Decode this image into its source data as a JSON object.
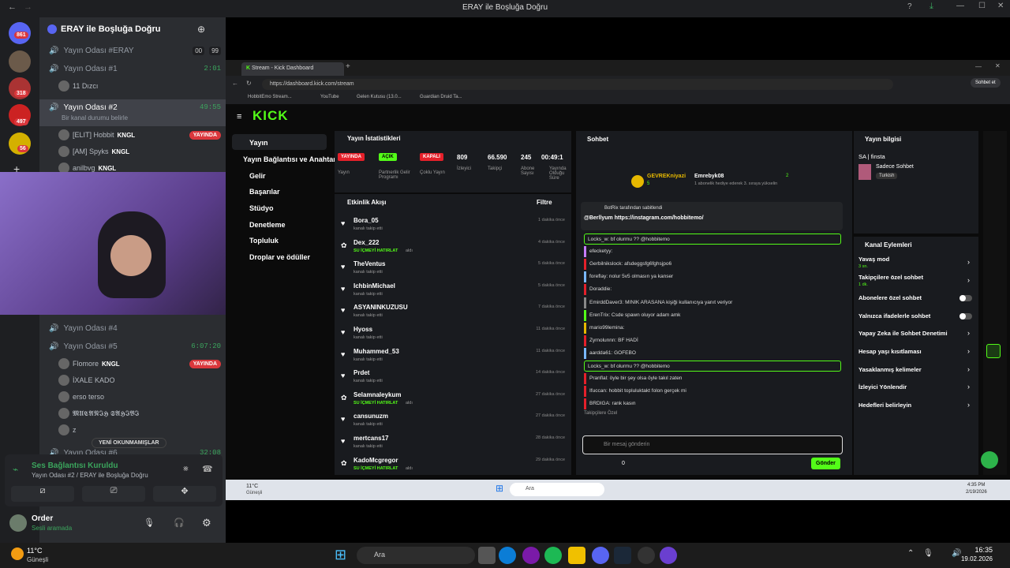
{
  "window_title": "ERAY ile Boşluğa Doğru",
  "server": {
    "name": "ERAY ile Boşluğa Doğru",
    "badges": [
      "861",
      "318",
      "497",
      "56"
    ]
  },
  "channels": {
    "yayin_durumu": {
      "label": "Yayın Odası #ERAY",
      "count_a": "00",
      "count_b": "99"
    },
    "oda1": {
      "label": "Yayın Odası #1",
      "timer": "2:01",
      "user": "11 Dızcı"
    },
    "oda2": {
      "label": "Yayın Odası #2",
      "timer": "49:55",
      "status": "Bir kanal durumu belirle"
    },
    "oda2_users": [
      {
        "name": "[ELIT] Hobbit",
        "tag": "KNGL",
        "live": "YAYINDA"
      },
      {
        "name": "[AM] Spyks",
        "tag": "KNGL",
        "live": ""
      },
      {
        "name": "anilbvg",
        "tag": "KNGL",
        "live": ""
      }
    ],
    "oda4": {
      "label": "Yayın Odası #4"
    },
    "oda5": {
      "label": "Yayın Odası #5",
      "timer": "6:07:20"
    },
    "oda5_users": [
      {
        "name": "Flomore",
        "tag": "KNGL",
        "live": "YAYINDA"
      },
      {
        "name": "İXALE KADO",
        "tag": "",
        "live": ""
      },
      {
        "name": "erso terso",
        "tag": "",
        "live": ""
      },
      {
        "name": "𝕸𝖀𝕮𝕬𝕹𝕴𝕳 𝕾𝕬𝕳𝕴𝕭𝕴",
        "tag": "",
        "live": ""
      },
      {
        "name": "z",
        "tag": "",
        "live": ""
      }
    ],
    "oda6": {
      "label": "Yayın Odası #6",
      "timer": "32:08"
    },
    "unread_pill": "YENİ OKUNMAMIŞLAR"
  },
  "voice": {
    "title": "Ses Bağlantısı Kuruldu",
    "subtitle": "Yayın Odası #2 / ERAY ile Boşluğa Doğru"
  },
  "user": {
    "name": "Order",
    "status": "Sesli aramada"
  },
  "browser": {
    "tab_title": "Stream - Kick Dashboard",
    "url": "https://dashboard.kick.com/stream",
    "bookmarks": [
      "HobbitEmo Stream...",
      "YouTube",
      "Gelen Kutusu (13.0...",
      "Guardian Druid Ta..."
    ],
    "chat_btn": "Sohbet et"
  },
  "kick": {
    "logo": "KICK",
    "menu": [
      "Yayın",
      "Yayın Bağlantısı ve Anahtarı",
      "Gelir",
      "Başarılar",
      "Stüdyo",
      "Denetleme",
      "Topluluk",
      "Droplar ve ödüller"
    ],
    "stats": {
      "title": "Yayın İstatistikleri",
      "items": [
        {
          "value": "YAYINDA",
          "label": "Yayın"
        },
        {
          "value": "AÇIK",
          "label": "Partnerlik Gelir Programı"
        },
        {
          "value": "KAPALI",
          "label": "Çoklu Yayın"
        },
        {
          "value": "809",
          "label": "İzleyici"
        },
        {
          "value": "66.590",
          "label": "Takipçi"
        },
        {
          "value": "245",
          "label": "Abone Sayısı"
        },
        {
          "value": "00:49:1",
          "label": "Yayında Olduğu Süre"
        }
      ]
    },
    "activity": {
      "title": "Etkinlik Akışı",
      "filter": "Filtre",
      "items": [
        {
          "name": "Bora_05",
          "sub": "kanalı takip etti",
          "hit": "",
          "time": "1 dakika önce"
        },
        {
          "name": "Dex_222",
          "sub": "aldı",
          "hit": "SU İÇMEYİ HATIRLAT",
          "time": "4 dakika önce"
        },
        {
          "name": "TheVentus",
          "sub": "kanalı takip etti",
          "hit": "",
          "time": "5 dakika önce"
        },
        {
          "name": "IchbinMichael",
          "sub": "kanalı takip etti",
          "hit": "",
          "time": "5 dakika önce"
        },
        {
          "name": "ASYANINKUZUSU",
          "sub": "kanalı takip etti",
          "hit": "",
          "time": "7 dakika önce"
        },
        {
          "name": "Hyoss",
          "sub": "kanalı takip etti",
          "hit": "",
          "time": "11 dakika önce"
        },
        {
          "name": "Muhammed_53",
          "sub": "kanalı takip etti",
          "hit": "",
          "time": "11 dakika önce"
        },
        {
          "name": "Prdet",
          "sub": "kanalı takip etti",
          "hit": "",
          "time": "14 dakika önce"
        },
        {
          "name": "Selamnaleykum",
          "sub": "aldı",
          "hit": "SU İÇMEYİ HATIRLAT",
          "time": "27 dakika önce"
        },
        {
          "name": "cansunuzm",
          "sub": "kanalı takip etti",
          "hit": "",
          "time": "27 dakika önce"
        },
        {
          "name": "mertcans17",
          "sub": "kanalı takip etti",
          "hit": "",
          "time": "28 dakika önce"
        },
        {
          "name": "KadoMcgregor",
          "sub": "aldı",
          "hit": "SU İÇMEYİ HATIRLAT",
          "time": "29 dakika önce"
        }
      ]
    },
    "chat": {
      "title": "Sohbet",
      "gifter1": "GEVREKniyazi",
      "gifter1_n": "5",
      "gifter2": "Emrebyk08",
      "gifter2_n": "2",
      "gift_note": "1 abonelik hediye ederek 3. sıraya yükselin",
      "pinned_by": "BotRix tarafından sabitlendi",
      "pinned_msg": "@Berllyum https://instagram.com/hobbitemo/",
      "messages": [
        "Locks_w: bf olurmu ?? @hobbitemo",
        "efecketyy:",
        "Gerbilnikslock: afsdeggsfg6fghsjpo6",
        "foreflay: nolur 5v5 olmasın ya kanser",
        "Doraddie:",
        "EmirddDaver3: MINIK ARASANA kişiği kullanıcıya yanıt veriyor",
        "ErenTrix: Csde spawn oluyor adam amk",
        "mario99lemina:",
        "Zyrnolunnn: BF HADİ",
        "aardda61: GOFEBO",
        "Locks_w: bf olurmu ?? @hobbitemo",
        "Pranflal: öyle bir şey olsa öyle takıl zaten",
        "Ifuccan: hobbit topluluktakt folon gerçek mi",
        "BRDIGA: rank kasın"
      ],
      "followers_only": "Takipçilere Özel",
      "placeholder": "Bir mesaj gönderin",
      "count": "0",
      "send": "Gönder"
    },
    "stream_info": {
      "title": "Yayın bilgisi",
      "name": "SA | finsta",
      "category": "Sadece Sohbet",
      "tag": "Turkish"
    },
    "channel_actions": {
      "title": "Kanal Eylemleri",
      "items": [
        {
          "label": "Yavaş mod",
          "sub": "3 sn."
        },
        {
          "label": "Takipçilere özel sohbet",
          "sub": "1 dk."
        },
        {
          "label": "Abonelere özel sohbet",
          "sub": ""
        },
        {
          "label": "Yalnızca ifadelerle sohbet",
          "sub": ""
        },
        {
          "label": "Yapay Zeka ile Sohbet Denetimi",
          "sub": ""
        },
        {
          "label": "Hesap yaşı kısıtlaması",
          "sub": ""
        },
        {
          "label": "Yasaklanmış kelimeler",
          "sub": ""
        },
        {
          "label": "İzleyici Yönlendir",
          "sub": ""
        },
        {
          "label": "Hedefleri belirleyin",
          "sub": ""
        }
      ]
    }
  },
  "inner_taskbar": {
    "weather": "11°C",
    "weather_sub": "Güneşli",
    "search": "Ara",
    "time": "4:35 PM",
    "date": "2/19/2026"
  },
  "taskbar": {
    "weather": "11°C",
    "weather_sub": "Güneşli",
    "search": "Ara",
    "time": "16:35",
    "date": "19.02.2026"
  }
}
